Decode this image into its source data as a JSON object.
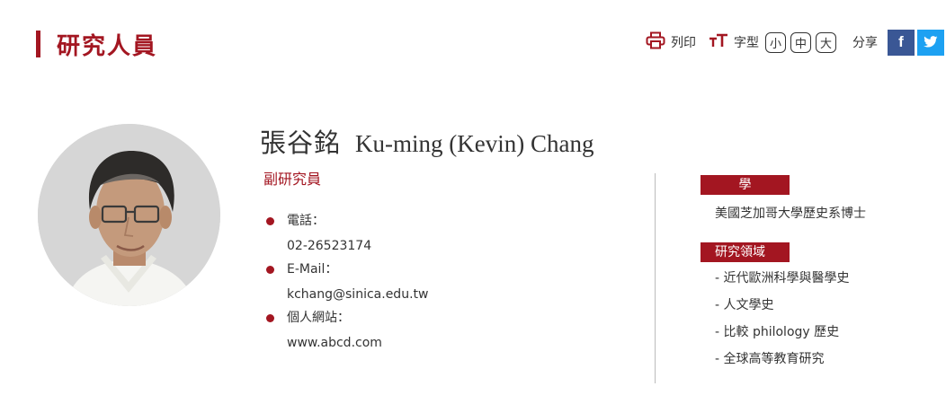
{
  "header": {
    "title": "研究人員"
  },
  "toolbar": {
    "print_label": "列印",
    "font_label": "字型",
    "sizes": [
      "小",
      "中",
      "大"
    ],
    "share_label": "分享",
    "facebook_glyph": "f",
    "icons": [
      "printer-icon",
      "font-size-icon",
      "facebook-icon",
      "twitter-icon"
    ]
  },
  "profile": {
    "name_zh": "張谷銘",
    "name_en": "Ku-ming (Kevin) Chang",
    "position": "副研究員",
    "contact": [
      {
        "label": "電話：",
        "value": "02-26523174"
      },
      {
        "label": "E-Mail：",
        "value": "kchang@sinica.edu.tw"
      },
      {
        "label": "個人網站：",
        "value": "www.abcd.com"
      }
    ]
  },
  "education": {
    "label": "學歷",
    "items": [
      "美國芝加哥大學歷史系博士"
    ]
  },
  "research": {
    "label": "研究領域",
    "items": [
      "- 近代歐洲科學與醫學史",
      "- 人文學史",
      "- 比較 philology 歷史",
      "- 全球高等教育研究"
    ]
  },
  "colors": {
    "accent": "#a31621",
    "facebook": "#3a5795",
    "twitter": "#1da1f2",
    "text": "#333333"
  }
}
